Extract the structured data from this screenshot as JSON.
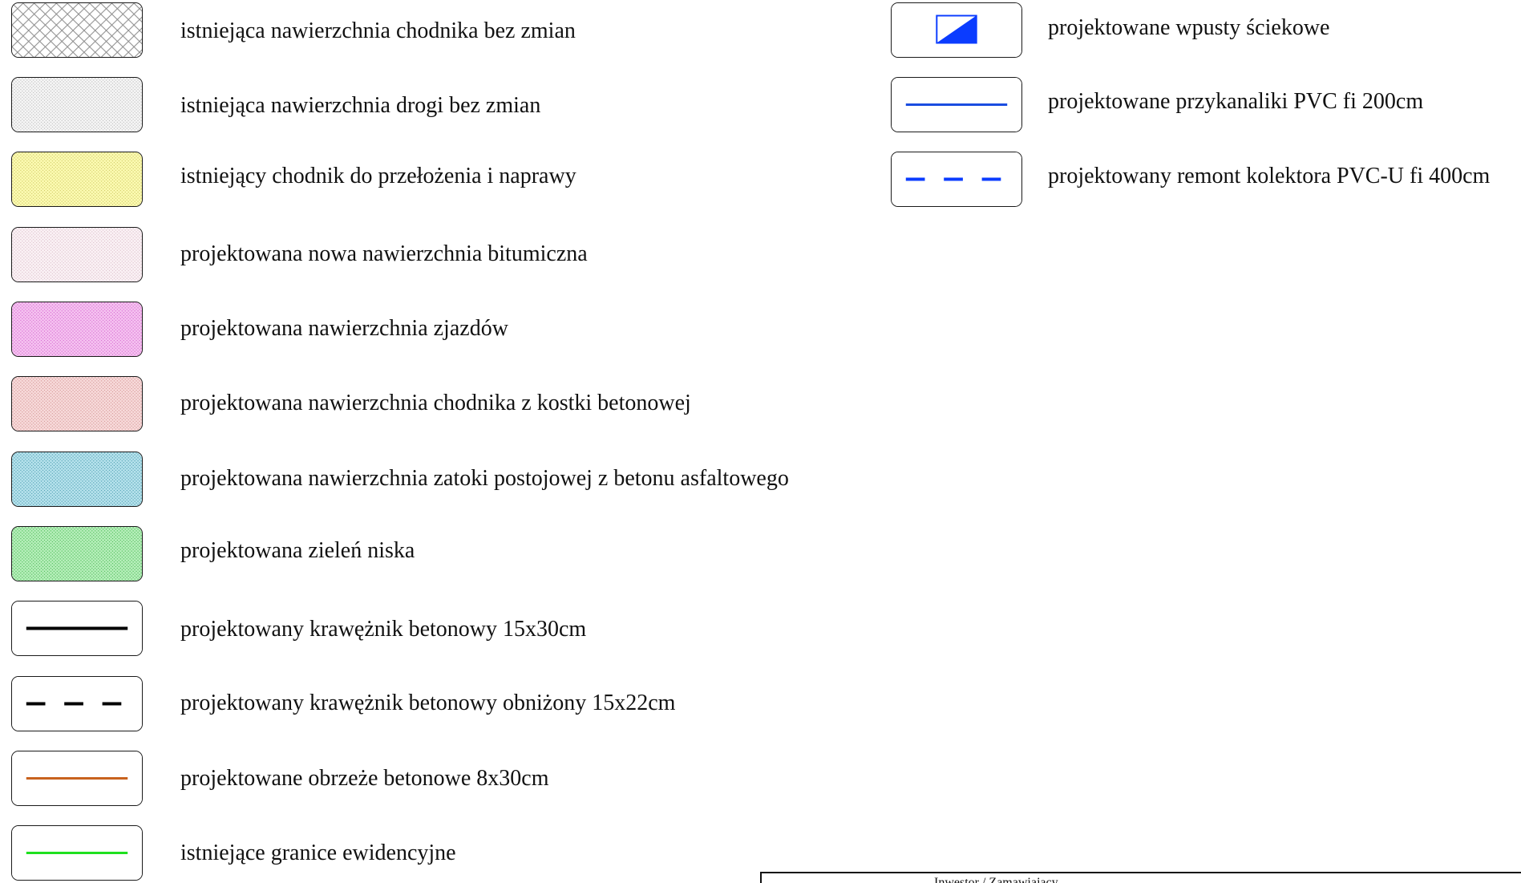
{
  "legend_left": [
    {
      "id": "existing-sidewalk",
      "label": "istniejąca nawierzchnia chodnika bez zmian",
      "pattern": "crosshatch",
      "fill": "#ffffff",
      "ink": "#8a8a8a"
    },
    {
      "id": "existing-road",
      "label": "istniejąca nawierzchnia drogi bez zmian",
      "pattern": "dots",
      "fill": "#f7f7f7",
      "ink": "#b5b5b5"
    },
    {
      "id": "sidewalk-relay",
      "label": "istniejący chodnik do przełożenia i naprawy",
      "pattern": "dots",
      "fill": "#fdfcb4",
      "ink": "#c9c25a"
    },
    {
      "id": "new-bitumen",
      "label": "projektowana nowa nawierzchnia bitumiczna",
      "pattern": "dots",
      "fill": "#fbf3f6",
      "ink": "#d8b7c4"
    },
    {
      "id": "driveways",
      "label": "projektowana nawierzchnia zjazdów",
      "pattern": "dots",
      "fill": "#f6c5f1",
      "ink": "#d15ccc"
    },
    {
      "id": "paver-sidewalk",
      "label": "projektowana nawierzchnia chodnika z kostki betonowej",
      "pattern": "dots",
      "fill": "#f8dcdc",
      "ink": "#d08c8c"
    },
    {
      "id": "parking-bay",
      "label": "projektowana nawierzchnia zatoki postojowej z betonu asfaltowego",
      "pattern": "dots",
      "fill": "#b9e4ee",
      "ink": "#3f94a8"
    },
    {
      "id": "low-greenery",
      "label": "projektowana zieleń niska",
      "pattern": "dots",
      "fill": "#b9f0bd",
      "ink": "#3fb44a"
    },
    {
      "id": "curb",
      "label": "projektowany krawężnik betonowy 15x30cm",
      "pattern": "solid-line",
      "fill": "#ffffff",
      "ink": "#000000"
    },
    {
      "id": "lowered-curb",
      "label": "projektowany krawężnik betonowy obniżony 15x22cm",
      "pattern": "dashed-line",
      "fill": "#ffffff",
      "ink": "#000000"
    },
    {
      "id": "edging",
      "label": "projektowane obrzeże betonowe 8x30cm",
      "pattern": "solid-line",
      "fill": "#ffffff",
      "ink": "#c8621e"
    },
    {
      "id": "boundaries",
      "label": "istniejące granice ewidencyjne",
      "pattern": "solid-line",
      "fill": "#ffffff",
      "ink": "#1fe01f"
    }
  ],
  "legend_right": [
    {
      "id": "gully-inlets",
      "label": "projektowane wpusty ściekowe",
      "pattern": "inlet",
      "fill": "#ffffff",
      "ink": "#0b3cff"
    },
    {
      "id": "connections",
      "label": "projektowane przykanaliki PVC fi 200cm",
      "pattern": "solid-line",
      "fill": "#ffffff",
      "ink": "#1a4de0"
    },
    {
      "id": "collector",
      "label": "projektowany remont kolektora PVC-U fi 400cm",
      "pattern": "dashed-line",
      "fill": "#ffffff",
      "ink": "#0b3cff"
    }
  ],
  "title_block": {
    "caption": "Inwestor / Zamawiający"
  }
}
